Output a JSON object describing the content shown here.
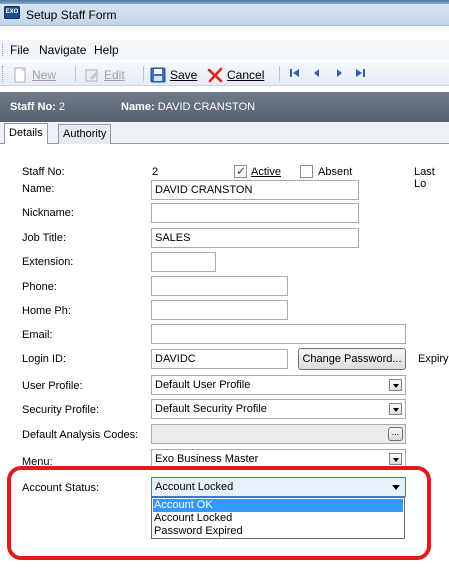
{
  "window": {
    "title": "Setup Staff Form"
  },
  "menu": [
    "File",
    "Navigate",
    "Help"
  ],
  "toolbar": {
    "new_label": "New",
    "edit_label": "Edit",
    "save_label": "Save",
    "cancel_label": "Cancel"
  },
  "header": {
    "staff_no_label": "Staff No:",
    "staff_no_value": "2",
    "name_label": "Name:",
    "name_value": "DAVID CRANSTON"
  },
  "tabs": [
    "Details",
    "Authority"
  ],
  "form": {
    "staff_no_label": "Staff No:",
    "staff_no_value": "2",
    "active_label": "Active",
    "active_checked": true,
    "absent_label": "Absent",
    "absent_checked": false,
    "last_login_label": "Last Lo",
    "name_label": "Name:",
    "name_value": "DAVID CRANSTON",
    "nickname_label": "Nickname:",
    "nickname_value": "",
    "job_title_label": "Job Title:",
    "job_title_value": "SALES",
    "extension_label": "Extension:",
    "extension_value": "",
    "phone_label": "Phone:",
    "phone_value": "",
    "home_ph_label": "Home Ph:",
    "home_ph_value": "",
    "email_label": "Email:",
    "email_value": "",
    "login_id_label": "Login ID:",
    "login_id_value": "DAVIDC",
    "change_password_label": "Change Password...",
    "expiry_label": "Expiry:",
    "user_profile_label": "User Profile:",
    "user_profile_value": "Default User Profile",
    "security_profile_label": "Security Profile:",
    "security_profile_value": "Default Security Profile",
    "default_analysis_label": "Default Analysis Codes:",
    "default_analysis_value": "",
    "analysis_button_label": "...",
    "menu_label": "Menu:",
    "menu_value": "Exo Business Master",
    "account_status_label": "Account Status:",
    "account_status_value": "Account Locked",
    "account_status_options": [
      "Account OK",
      "Account Locked",
      "Password Expired"
    ]
  },
  "colors": {
    "highlight": "#e01b1b",
    "selection": "#3399ff",
    "header_strip": "#5f6b79"
  }
}
